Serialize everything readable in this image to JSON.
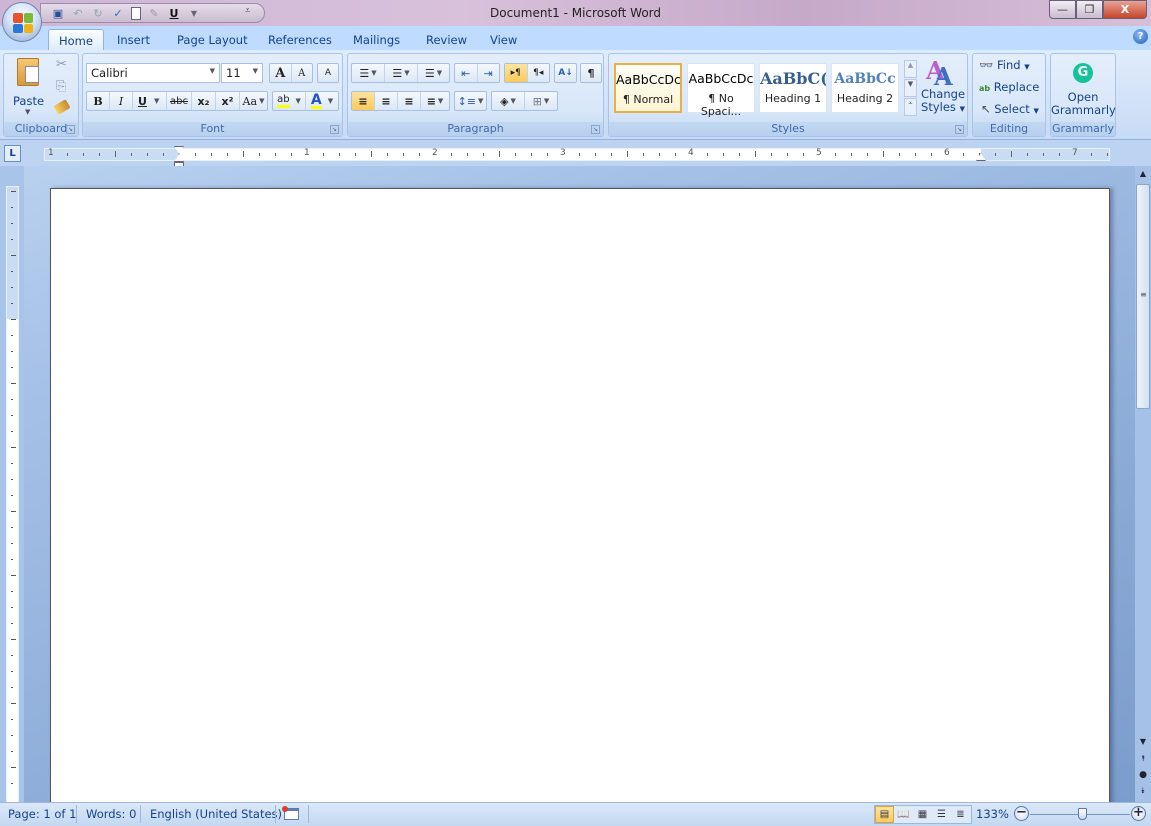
{
  "window": {
    "title": "Document1 - Microsoft Word",
    "controls": {
      "minimize": "—",
      "restore": "❐",
      "close": "X"
    }
  },
  "quick_access": [
    {
      "name": "save-icon",
      "glyph": "💾"
    },
    {
      "name": "undo-icon",
      "glyph": "↶"
    },
    {
      "name": "redo-icon",
      "glyph": "↷"
    },
    {
      "name": "spelling-icon",
      "glyph": "✓"
    },
    {
      "name": "new-document-icon",
      "glyph": "▯"
    },
    {
      "name": "draw-icon",
      "glyph": "✎"
    },
    {
      "name": "underline-icon",
      "glyph": "U"
    },
    {
      "name": "customize-icon",
      "glyph": "▾"
    }
  ],
  "tabs": [
    "Home",
    "Insert",
    "Page Layout",
    "References",
    "Mailings",
    "Review",
    "View"
  ],
  "active_tab": "Home",
  "help_glyph": "?",
  "ribbon": {
    "clipboard": {
      "label": "Clipboard",
      "paste": "Paste",
      "cut_glyph": "✂",
      "copy_glyph": "⎘",
      "format_painter_glyph": "🖌"
    },
    "font": {
      "label": "Font",
      "font_name": "Calibri",
      "font_size": "11",
      "grow": "A",
      "shrink": "A",
      "clear": "A",
      "bold": "B",
      "italic": "I",
      "underline": "U",
      "strike": "abc",
      "subscript": "x₂",
      "superscript": "x²",
      "change_case": "Aa",
      "highlight": "ab",
      "font_color": "A",
      "highlight_color": "#ffff00",
      "font_color_value": "#ff0000"
    },
    "paragraph": {
      "label": "Paragraph",
      "bullets": "☰",
      "numbering": "☰",
      "multilevel": "☰",
      "decrease_indent": "⇤",
      "increase_indent": "⇥",
      "ltr": "▸¶",
      "rtl": "¶◂",
      "sort": "A↓",
      "show_marks": "¶",
      "align_left": "≡",
      "center": "≡",
      "align_right": "≡",
      "justify": "≡",
      "line_spacing": "↕≡",
      "shading": "◈",
      "borders": "⊞"
    },
    "styles": {
      "label": "Styles",
      "items": [
        {
          "preview": "AaBbCcDc",
          "name": "¶ Normal",
          "selected": true
        },
        {
          "preview": "AaBbCcDc",
          "name": "¶ No Spaci...",
          "selected": false
        },
        {
          "preview": "AaBbC(",
          "name": "Heading 1",
          "selected": false
        },
        {
          "preview": "AaBbCc",
          "name": "Heading 2",
          "selected": false
        }
      ],
      "change_styles": "Change Styles",
      "change_styles_line1": "Change",
      "change_styles_line2": "Styles"
    },
    "editing": {
      "label": "Editing",
      "find": "Find",
      "replace": "Replace",
      "select": "Select"
    },
    "grammarly": {
      "label": "Grammarly",
      "open_line1": "Open",
      "open_line2": "Grammarly",
      "brand_color": "#15c39a"
    }
  },
  "ruler": {
    "numbers": [
      "1",
      "1",
      "2",
      "3",
      "4",
      "5",
      "6",
      "7"
    ],
    "tab_selector": "L"
  },
  "statusbar": {
    "page": "Page: 1 of 1",
    "words": "Words: 0",
    "language": "English (United States)",
    "zoom": "133%",
    "zoom_percent": 133,
    "zoom_minus": "−",
    "zoom_plus": "+"
  }
}
